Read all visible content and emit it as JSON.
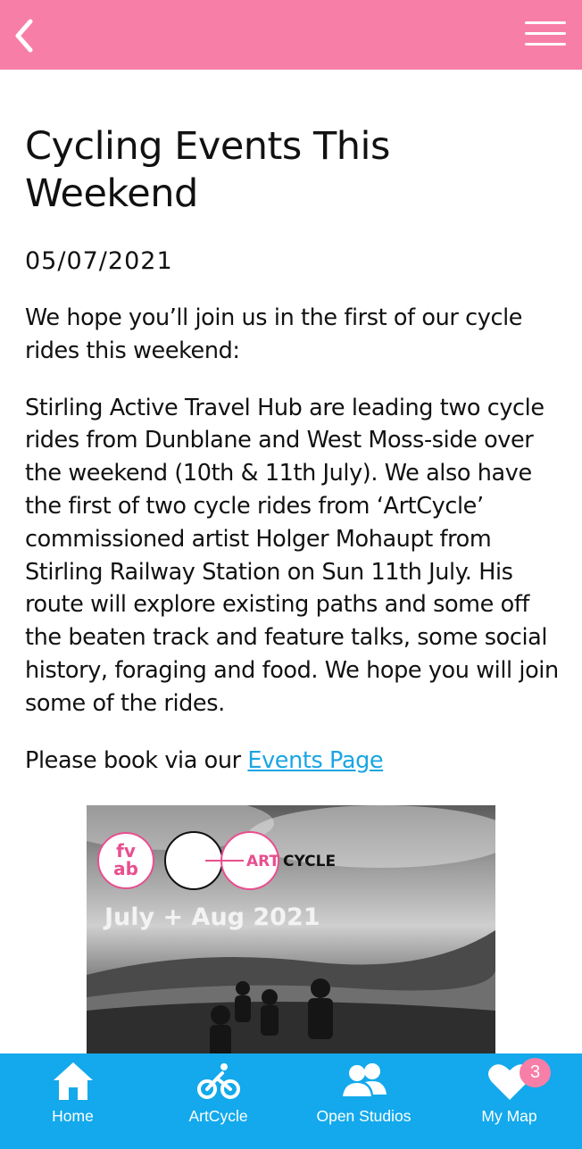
{
  "header": {
    "back_icon": "chevron-left-icon",
    "menu_icon": "hamburger-menu-icon",
    "accent": "#f77fa7"
  },
  "article": {
    "title": "Cycling Events This Weekend",
    "date": "05/07/2021",
    "intro": "We hope you’ll join us in the first of our cycle rides this weekend:",
    "body": "Stirling Active Travel Hub are leading two cycle rides from Dunblane and West Moss-side over the weekend (10th & 11th July). We also have the first of two cycle rides from ‘ArtCycle’ commissioned artist Holger Mohaupt from Stirling Railway Station on Sun 11th July. His route will explore existing paths and some off the beaten track and feature talks, some social history, foraging and food. We hope you will join some of the rides.",
    "book_prefix": "Please book via our ",
    "book_link": "Events Page",
    "link_color": "#1aa5e3"
  },
  "banner": {
    "logo_text_1": "fv",
    "logo_text_2": "ab",
    "art_label": "ART",
    "cycle_label": "CYCLE",
    "dates": "July + Aug 2021"
  },
  "tabs": [
    {
      "label": "Home",
      "icon": "home-icon"
    },
    {
      "label": "ArtCycle",
      "icon": "bicycle-icon"
    },
    {
      "label": "Open Studios",
      "icon": "users-icon"
    },
    {
      "label": "My Map",
      "icon": "heart-icon",
      "badge": "3"
    }
  ],
  "tabbar_color": "#13a9ec"
}
